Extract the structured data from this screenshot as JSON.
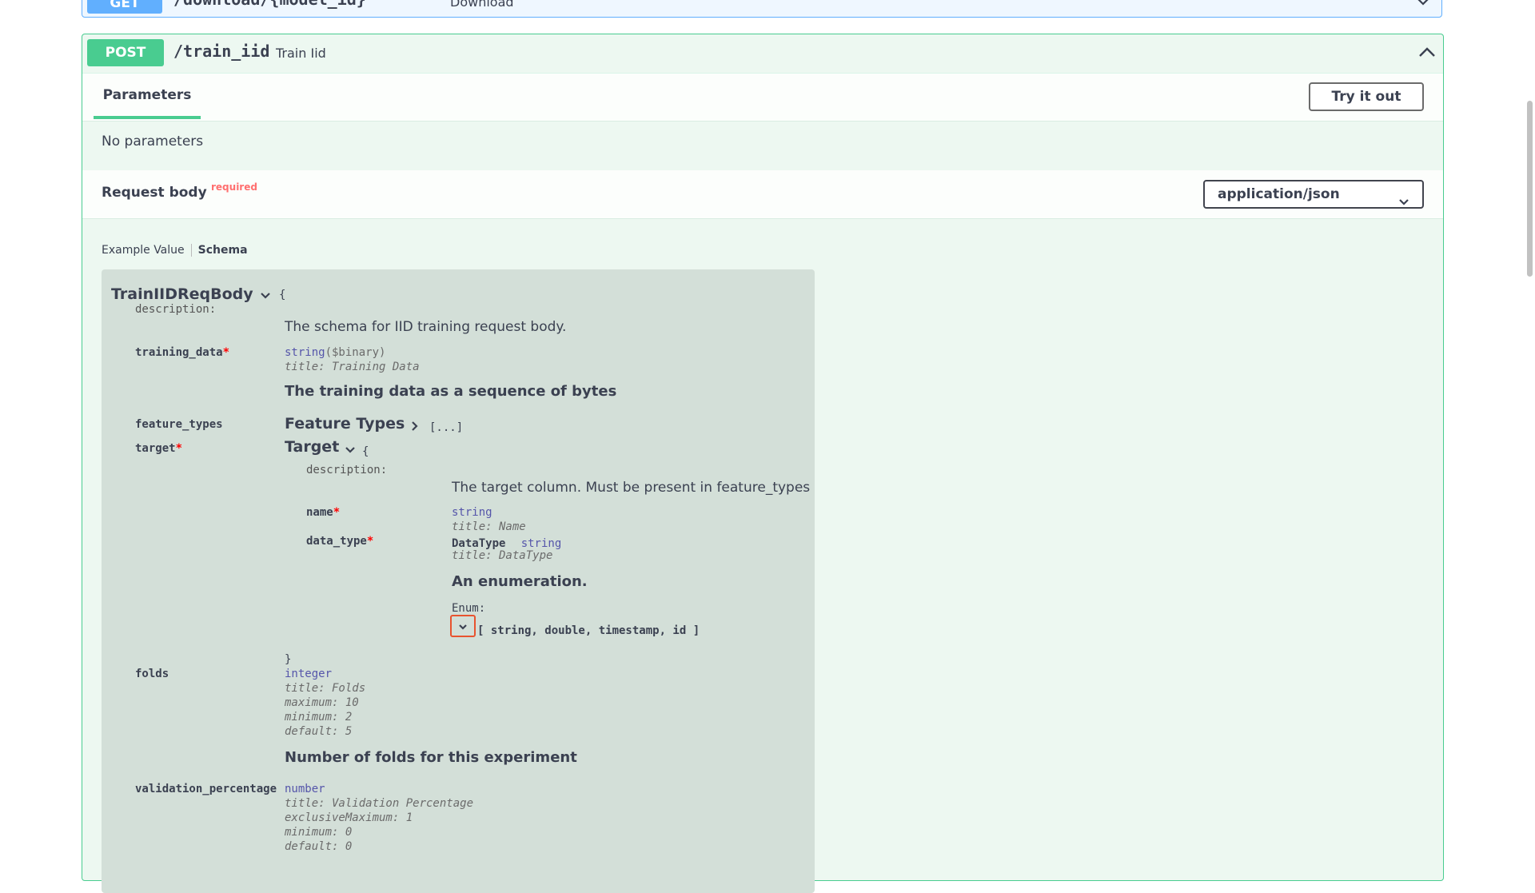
{
  "get_op": {
    "method": "GET",
    "path": "/download/{model_id}",
    "summary": "Download"
  },
  "post_op": {
    "method": "POST",
    "path": "/train_iid",
    "summary": "Train Iid"
  },
  "parameters": {
    "tab_label": "Parameters",
    "try_label": "Try it out",
    "empty_text": "No parameters"
  },
  "request_body": {
    "title": "Request body",
    "required_label": "required",
    "content_type": "application/json"
  },
  "example_tabs": {
    "example_label": "Example Value",
    "schema_label": "Schema"
  },
  "schema": {
    "model_name": "TrainIIDReqBody",
    "open_brace": "{",
    "close_brace": "}",
    "description_key": "description:",
    "description": "The schema for IID training request body.",
    "training_data": {
      "name": "training_data",
      "type": "string",
      "format": "($binary)",
      "title": "title: Training Data",
      "description": "The training data as a sequence of bytes"
    },
    "feature_types": {
      "name": "feature_types",
      "model": "Feature Types",
      "collapsed": "[...]"
    },
    "target": {
      "name": "target",
      "model": "Target",
      "open_brace": "{",
      "close_brace": "}",
      "description_key": "description:",
      "description": "The target column. Must be present in feature_types",
      "name_prop": {
        "name": "name",
        "type": "string",
        "title": "title: Name"
      },
      "data_type_prop": {
        "name": "data_type",
        "model": "DataType",
        "type": "string",
        "title": "title: DataType",
        "description": "An enumeration.",
        "enum_label": "Enum:",
        "enum_values": "[ string, double, timestamp, id ]"
      }
    },
    "folds": {
      "name": "folds",
      "type": "integer",
      "title": "title: Folds",
      "maximum": "maximum: 10",
      "minimum": "minimum: 2",
      "default": "default: 5",
      "description": "Number of folds for this experiment"
    },
    "validation_percentage": {
      "name": "validation_percentage",
      "type": "number",
      "title": "title: Validation Percentage",
      "exclusive_maximum": "exclusiveMaximum: 1",
      "minimum": "minimum: 0",
      "default": "default: 0"
    }
  },
  "colors": {
    "post": "#49cc90",
    "get": "#61affe",
    "required": "#ff0000",
    "type": "#5555aa"
  }
}
